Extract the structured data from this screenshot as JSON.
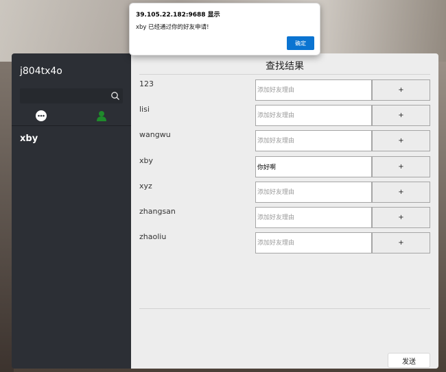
{
  "alert": {
    "title": "39.105.22.182:9688 显示",
    "message": "xby 已经通过你的好友申请!",
    "ok_label": "确定"
  },
  "sidebar": {
    "username": "j804tx4o",
    "search": {
      "value": "",
      "placeholder": ""
    },
    "icons": [
      "chat-icon",
      "contacts-icon"
    ],
    "friends": [
      {
        "name": "xby"
      }
    ]
  },
  "main": {
    "title": "查找结果",
    "reason_placeholder": "添加好友理由",
    "add_label": "+",
    "results": [
      {
        "name": "123",
        "reason": ""
      },
      {
        "name": "lisi",
        "reason": ""
      },
      {
        "name": "wangwu",
        "reason": ""
      },
      {
        "name": "xby",
        "reason": "你好啊"
      },
      {
        "name": "xyz",
        "reason": ""
      },
      {
        "name": "zhangsan",
        "reason": ""
      },
      {
        "name": "zhaoliu",
        "reason": ""
      }
    ],
    "send_label": "发送"
  },
  "colors": {
    "sidebar_bg": "#2c2f35",
    "main_bg": "#ededed",
    "contacts_icon": "#1f8a2b",
    "ok_button": "#0b74d1"
  }
}
